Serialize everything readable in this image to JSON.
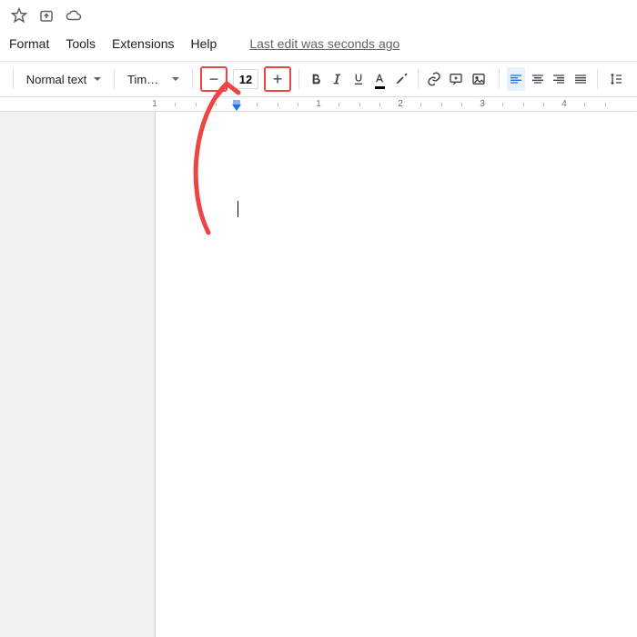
{
  "menu": {
    "format": "Format",
    "tools": "Tools",
    "extensions": "Extensions",
    "help": "Help",
    "lastEdit": "Last edit was seconds ago"
  },
  "toolbar": {
    "styleCombo": "Normal text",
    "fontCombo": "Times New…",
    "fontSize": "12"
  },
  "ruler": {
    "r1": "1",
    "r2": "2",
    "r3": "3",
    "r4": "4"
  },
  "annotation": {
    "highlightColor": "#ef4444"
  }
}
